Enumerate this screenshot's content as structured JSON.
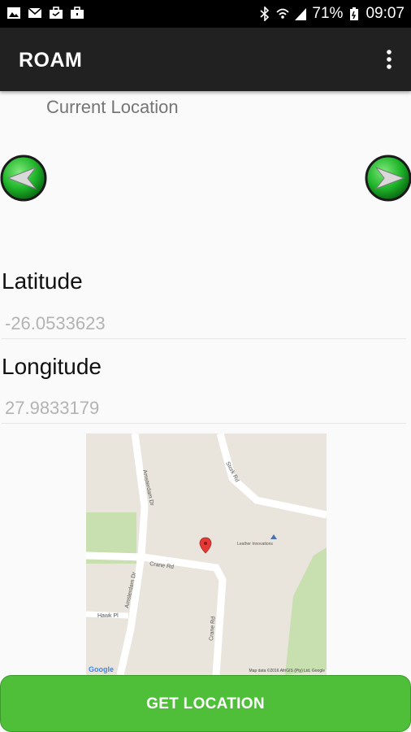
{
  "status_bar": {
    "left_icons": [
      "image-icon",
      "email-icon",
      "briefcase-icon",
      "briefcase-icon"
    ],
    "battery": "71%",
    "time": "09:07",
    "right_icons": [
      "bluetooth-icon",
      "wifi-icon",
      "signal-icon",
      "battery-icon"
    ]
  },
  "app_bar": {
    "title": "ROAM",
    "overflow_icon": "more-vert-icon"
  },
  "main": {
    "section_title": "Current Location",
    "prev_icon": "arrow-left-icon",
    "next_icon": "arrow-right-icon",
    "latitude_label": "Latitude",
    "latitude_value": "-26.0533623",
    "longitude_label": "Longitude",
    "longitude_value": "27.9833179"
  },
  "map": {
    "streets": [
      "Amsterdam Dr",
      "Crane Rd",
      "Crane Rd",
      "Stork Rd",
      "Hawk Pl",
      "Amsterdam Dr"
    ],
    "poi": "Leather Innovations",
    "marker_icon": "map-pin-icon",
    "provider": "Google",
    "credit": "Map data ©2016 AfriGIS (Pty) Ltd, Google"
  },
  "actions": {
    "get_location_label": "GET LOCATION"
  },
  "colors": {
    "accent_green": "#4fbf3a",
    "app_bar": "#212121",
    "status_bar": "#000000",
    "marker_red": "#e53935"
  }
}
